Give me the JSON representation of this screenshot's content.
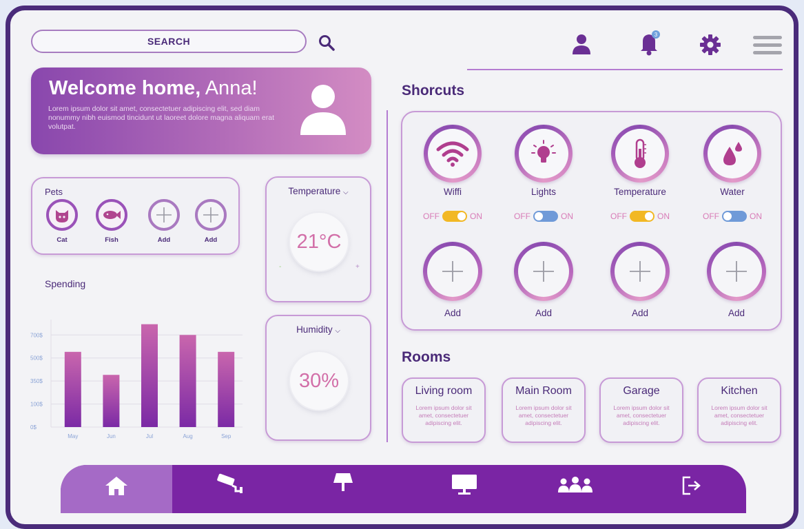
{
  "search": {
    "label": "SEARCH"
  },
  "header": {
    "notification_count": "3"
  },
  "welcome": {
    "greeting": "Welcome home,",
    "name": "Anna!",
    "text": "Lorem ipsum dolor sit amet, consectetuer adipiscing elit, sed diam nonummy nibh euismod tincidunt ut laoreet dolore magna aliquam erat volutpat."
  },
  "pets": {
    "title": "Pets",
    "items": [
      {
        "label": "Cat",
        "icon": "cat-icon"
      },
      {
        "label": "Fish",
        "icon": "fish-icon"
      },
      {
        "label": "Add",
        "icon": "plus-icon"
      },
      {
        "label": "Add",
        "icon": "plus-icon"
      }
    ]
  },
  "temperature": {
    "title": "Temperature",
    "value": "21°C",
    "minus": "-",
    "plus": "+"
  },
  "humidity": {
    "title": "Humidity",
    "value": "30%"
  },
  "spending": {
    "title": "Spending"
  },
  "chart_data": {
    "type": "bar",
    "categories": [
      "May",
      "Jun",
      "Jul",
      "Aug",
      "Sep"
    ],
    "values": [
      490,
      340,
      670,
      600,
      490
    ],
    "yticks": [
      "0$",
      "100$",
      "350$",
      "500$",
      "700$"
    ],
    "ytick_values": [
      0,
      150,
      300,
      450,
      600
    ],
    "ylim": [
      0,
      700
    ],
    "grid": true,
    "colors": {
      "top": "#c966ad",
      "bottom": "#7b2aa5"
    }
  },
  "shortcuts": {
    "title": "Shorcuts",
    "items": [
      {
        "label": "Wiffi",
        "icon": "wifi-icon",
        "off": "OFF",
        "on": "ON",
        "toggle_color": "#f2b824"
      },
      {
        "label": "Lights",
        "icon": "lightbulb-icon",
        "off": "OFF",
        "on": "ON",
        "toggle_color": "#6f9ad8"
      },
      {
        "label": "Temperature",
        "icon": "thermometer-icon",
        "off": "OFF",
        "on": "ON",
        "toggle_color": "#f2b824"
      },
      {
        "label": "Water",
        "icon": "water-drop-icon",
        "off": "OFF",
        "on": "ON",
        "toggle_color": "#6f9ad8"
      }
    ],
    "add_items": [
      "Add",
      "Add",
      "Add",
      "Add"
    ]
  },
  "rooms": {
    "title": "Rooms",
    "items": [
      {
        "title": "Living room",
        "text": "Lorem ipsum dolor sit amet, consectetuer adipiscing elit."
      },
      {
        "title": "Main Room",
        "text": "Lorem ipsum dolor sit amet, consectetuer adipiscing elit."
      },
      {
        "title": "Garage",
        "text": "Lorem ipsum dolor sit amet, consectetuer adipiscing elit."
      },
      {
        "title": "Kitchen",
        "text": "Lorem ipsum dolor sit amet, consectetuer adipiscing elit."
      }
    ]
  },
  "nav": {
    "items": [
      "home-icon",
      "security-camera-icon",
      "lamp-icon",
      "monitor-icon",
      "people-icon",
      "logout-icon"
    ],
    "active": "home-icon"
  }
}
